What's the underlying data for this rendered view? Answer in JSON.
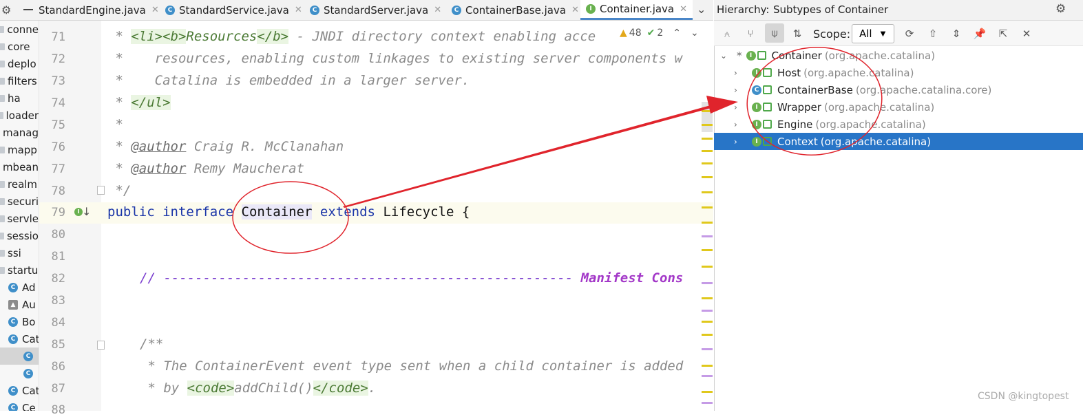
{
  "tabs": [
    {
      "label": "StandardEngine.java",
      "icon": "class-icon"
    },
    {
      "label": "StandardService.java",
      "icon": "class-icon"
    },
    {
      "label": "StandardServer.java",
      "icon": "class-icon"
    },
    {
      "label": "ContainerBase.java",
      "icon": "class-icon"
    },
    {
      "label": "Container.java",
      "icon": "interface-icon",
      "active": true
    }
  ],
  "project_tree": [
    "conne",
    "core",
    "deplo",
    "filters",
    "ha",
    "loader",
    "manag",
    "mapp",
    "mbean",
    "realm",
    "securi",
    "servle",
    "sessio",
    "ssi",
    "startu",
    "Ad",
    "Au",
    "Bo",
    "Cat",
    "",
    "",
    "Cat",
    "Ce"
  ],
  "inspections": {
    "warnings": "48",
    "ok": "2"
  },
  "editor": {
    "line_numbers": [
      "71",
      "72",
      "73",
      "74",
      "75",
      "76",
      "77",
      "78",
      "79",
      "80",
      "81",
      "82",
      "83",
      "84",
      "85",
      "86",
      "87",
      "88"
    ],
    "lines": {
      "l71_pre": " * ",
      "l71_tag1": "<li><b>",
      "l71_text": "Resources",
      "l71_tag2": "</b>",
      "l71_post": " - JNDI directory context enabling acce",
      "l72": " *    resources, enabling custom linkages to existing server components w",
      "l73": " *    Catalina is embedded in a larger server.",
      "l74_pre": " * ",
      "l74_tag": "</ul>",
      "l75": " *",
      "l76_pre": " * ",
      "l76_ann": "@author",
      "l76_post": " Craig R. McClanahan",
      "l77_pre": " * ",
      "l77_ann": "@author",
      "l77_post": " Remy Maucherat",
      "l78": " */",
      "l79_kw1": "public",
      "l79_kw2": "interface",
      "l79_name": "Container",
      "l79_kw3": "extends",
      "l79_rest": "Lifecycle {",
      "l82_dash": "// ----------------------------------------------------",
      "l82_manifest": "Manifest Cons",
      "l85": "/**",
      "l86": " * The ContainerEvent event type sent when a child container is added",
      "l87_pre": " * by ",
      "l87_tag1": "<code>",
      "l87_text": "addChild()",
      "l87_tag2": "</code>",
      "l87_post": "."
    }
  },
  "hierarchy": {
    "title": "Hierarchy:",
    "subtitle": "Subtypes of Container",
    "scope_label": "Scope:",
    "scope_value": "All",
    "root": {
      "name": "Container",
      "pkg": "(org.apache.catalina)"
    },
    "children": [
      {
        "name": "Host",
        "pkg": "(org.apache.catalina)",
        "icon": "interface-icon"
      },
      {
        "name": "ContainerBase",
        "pkg": "(org.apache.catalina.core)",
        "icon": "class-icon"
      },
      {
        "name": "Wrapper",
        "pkg": "(org.apache.catalina)",
        "icon": "interface-icon"
      },
      {
        "name": "Engine",
        "pkg": "(org.apache.catalina)",
        "icon": "interface-icon"
      },
      {
        "name": "Context",
        "pkg": "(org.apache.catalina)",
        "icon": "interface-icon",
        "selected": true
      }
    ]
  },
  "watermark": "CSDN @kingtopest",
  "colors": {
    "selection": "#2875c7",
    "annotation_red": "#e0242c",
    "accent_tab": "#4a86c8"
  }
}
